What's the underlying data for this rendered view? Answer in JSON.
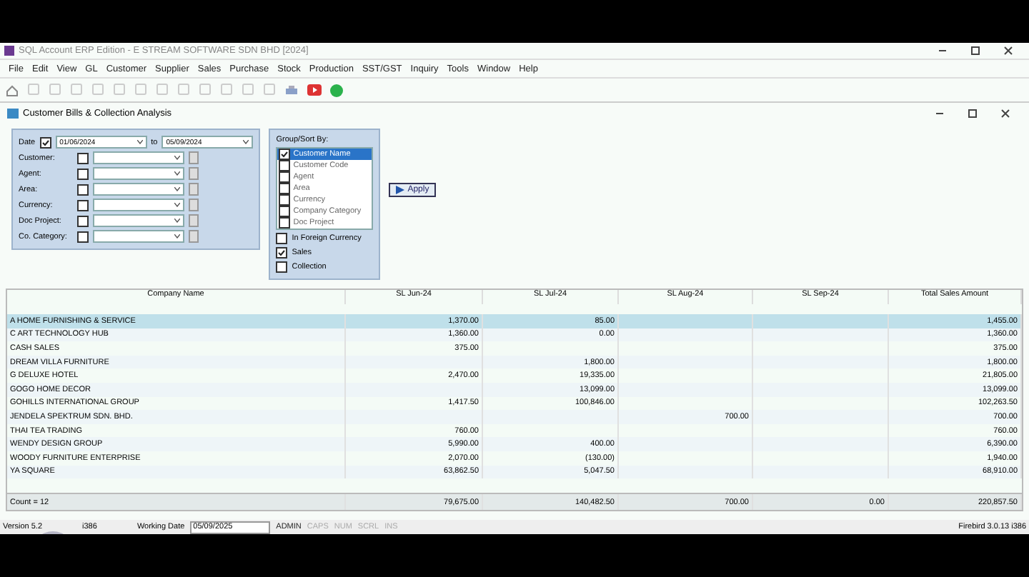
{
  "app": {
    "title": "SQL Account ERP Edition - E STREAM SOFTWARE SDN BHD [2024]"
  },
  "menu": [
    "File",
    "Edit",
    "View",
    "GL",
    "Customer",
    "Supplier",
    "Sales",
    "Purchase",
    "Stock",
    "Production",
    "SST/GST",
    "Inquiry",
    "Tools",
    "Window",
    "Help"
  ],
  "window": {
    "title": "Customer Bills & Collection Analysis"
  },
  "filter": {
    "date_label": "Date",
    "date_checked": true,
    "date_from": "01/06/2024",
    "to_label": "to",
    "date_to": "05/09/2024",
    "fields": [
      {
        "label": "Customer:",
        "checked": false
      },
      {
        "label": "Agent:",
        "checked": false
      },
      {
        "label": "Area:",
        "checked": false
      },
      {
        "label": "Currency:",
        "checked": false
      },
      {
        "label": "Doc Project:",
        "checked": false
      },
      {
        "label": "Co. Category:",
        "checked": false
      }
    ]
  },
  "group_sort": {
    "title": "Group/Sort By:",
    "items": [
      {
        "label": "Customer Name",
        "checked": true,
        "selected": true
      },
      {
        "label": "Customer Code",
        "checked": false,
        "selected": false
      },
      {
        "label": "Agent",
        "checked": false,
        "selected": false
      },
      {
        "label": "Area",
        "checked": false,
        "selected": false
      },
      {
        "label": "Currency",
        "checked": false,
        "selected": false
      },
      {
        "label": "Company Category",
        "checked": false,
        "selected": false
      },
      {
        "label": "Doc Project",
        "checked": false,
        "selected": false
      }
    ],
    "options": [
      {
        "label": "In Foreign Currency",
        "checked": false
      },
      {
        "label": "Sales",
        "checked": true
      },
      {
        "label": "Collection",
        "checked": false
      }
    ]
  },
  "apply_button": "Apply",
  "table": {
    "columns": [
      "Company Name",
      "SL Jun-24",
      "SL Jul-24",
      "SL Aug-24",
      "SL Sep-24",
      "Total Sales Amount"
    ],
    "rows": [
      {
        "cells": [
          "A HOME FURNISHING & SERVICE",
          "1,370.00",
          "85.00",
          "",
          "",
          "1,455.00"
        ],
        "selected": true
      },
      {
        "cells": [
          "C ART TECHNOLOGY HUB",
          "1,360.00",
          "0.00",
          "",
          "",
          "1,360.00"
        ],
        "selected": false
      },
      {
        "cells": [
          "CASH SALES",
          "375.00",
          "",
          "",
          "",
          "375.00"
        ],
        "selected": false
      },
      {
        "cells": [
          "DREAM VILLA FURNITURE",
          "",
          "1,800.00",
          "",
          "",
          "1,800.00"
        ],
        "selected": false
      },
      {
        "cells": [
          "G DELUXE HOTEL",
          "2,470.00",
          "19,335.00",
          "",
          "",
          "21,805.00"
        ],
        "selected": false
      },
      {
        "cells": [
          "GOGO HOME DECOR",
          "",
          "13,099.00",
          "",
          "",
          "13,099.00"
        ],
        "selected": false
      },
      {
        "cells": [
          "GOHILLS INTERNATIONAL GROUP",
          "1,417.50",
          "100,846.00",
          "",
          "",
          "102,263.50"
        ],
        "selected": false
      },
      {
        "cells": [
          "JENDELA SPEKTRUM SDN. BHD.",
          "",
          "",
          "700.00",
          "",
          "700.00"
        ],
        "selected": false
      },
      {
        "cells": [
          "THAI TEA TRADING",
          "760.00",
          "",
          "",
          "",
          "760.00"
        ],
        "selected": false
      },
      {
        "cells": [
          "WENDY DESIGN GROUP",
          "5,990.00",
          "400.00",
          "",
          "",
          "6,390.00"
        ],
        "selected": false
      },
      {
        "cells": [
          "WOODY FURNITURE ENTERPRISE",
          "2,070.00",
          "(130.00)",
          "",
          "",
          "1,940.00"
        ],
        "selected": false
      },
      {
        "cells": [
          "YA SQUARE",
          "63,862.50",
          "5,047.50",
          "",
          "",
          "68,910.00"
        ],
        "selected": false
      }
    ],
    "footer": [
      "Count = 12",
      "79,675.00",
      "140,482.50",
      "700.00",
      "0.00",
      "220,857.50"
    ]
  },
  "status_bar": {
    "version": "Version 5.2",
    "build": "i386",
    "working_date_label": "Working Date",
    "working_date": "05/09/2025",
    "user": "ADMIN",
    "keys": [
      "CAPS",
      "NUM",
      "SCRL",
      "INS"
    ],
    "db": "Firebird 3.0.13 i386"
  }
}
